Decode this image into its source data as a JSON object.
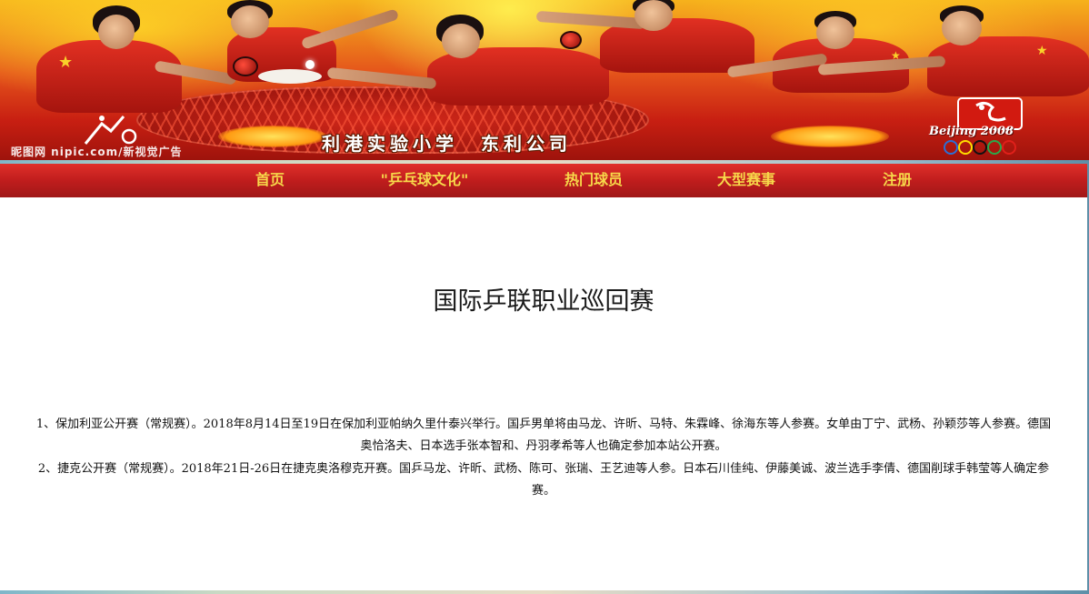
{
  "banner": {
    "caption": "利港实验小学　东利公司",
    "watermark": "昵图网 nipic.com/新视觉广告",
    "olympic_text": "Beijing 2008"
  },
  "nav": {
    "items": [
      {
        "label": "首页"
      },
      {
        "label": "\"乒乓球文化\""
      },
      {
        "label": "热门球员"
      },
      {
        "label": "大型赛事"
      },
      {
        "label": "注册"
      }
    ]
  },
  "main": {
    "title": "国际乒联职业巡回赛",
    "paragraphs": [
      {
        "line1": "1、保加利亚公开赛（常规赛）。2018年8月14日至19日在保加利亚帕纳久里什泰兴举行。国乒男单将由马龙、许昕、马特、朱霖峰、徐海东等人参赛。女单由丁宁、武杨、孙颖莎等人参赛。德国",
        "line2": "奥恰洛夫、日本选手张本智和、丹羽孝希等人也确定参加本站公开赛。"
      },
      {
        "line1": "2、捷克公开赛（常规赛）。2018年21日-26日在捷克奥洛穆克开赛。国乒马龙、许昕、武杨、陈可、张瑞、王艺迪等人参。日本石川佳纯、伊藤美诚、波兰选手李倩、德国削球手韩莹等人确定参",
        "line2": "赛。"
      }
    ]
  },
  "colors": {
    "nav_bg": "#c01d1d",
    "nav_text": "#f7d84a",
    "content_bg": "#ffffff"
  }
}
